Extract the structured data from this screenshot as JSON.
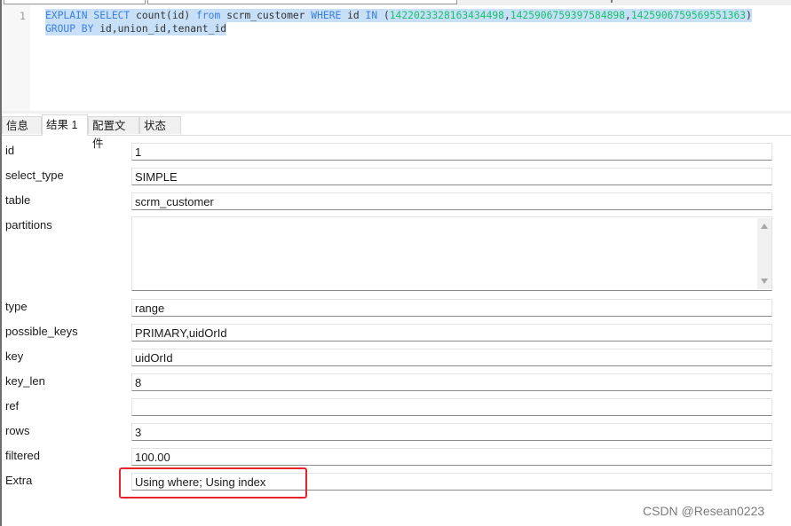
{
  "editor": {
    "line_number": "1",
    "line1": {
      "kw1": "EXPLAIN SELECT",
      "t1": " count(id) ",
      "kw2": "from",
      "t2": " scrm_customer ",
      "kw3": "WHERE",
      "t3": " id ",
      "kw4": "IN",
      "p_open": " (",
      "n1": "1422023328163434498",
      "c1": ",",
      "n2": "1425906759397584898",
      "c2": ",",
      "n3": "1425906759569551363",
      "p_close": ")"
    },
    "line2": {
      "kw": "GROUP BY",
      "t": " id,union_id,tenant_id"
    }
  },
  "tabs": [
    {
      "label": "信息",
      "active": false
    },
    {
      "label": "结果 1",
      "active": true
    },
    {
      "label": "配置文件",
      "active": false
    },
    {
      "label": "状态",
      "active": false
    }
  ],
  "fields": [
    {
      "label": "id",
      "value": "1"
    },
    {
      "label": "select_type",
      "value": "SIMPLE"
    },
    {
      "label": "table",
      "value": "scrm_customer"
    },
    {
      "label": "partitions",
      "value": ""
    },
    {
      "label": "type",
      "value": "range"
    },
    {
      "label": "possible_keys",
      "value": "PRIMARY,uidOrId"
    },
    {
      "label": "key",
      "value": "uidOrId"
    },
    {
      "label": "key_len",
      "value": "8"
    },
    {
      "label": "ref",
      "value": ""
    },
    {
      "label": "rows",
      "value": "3"
    },
    {
      "label": "filtered",
      "value": "100.00"
    },
    {
      "label": "Extra",
      "value": "Using where; Using index"
    }
  ],
  "annotation": {
    "color": "#e8242a",
    "target": "Extra"
  },
  "watermark": "CSDN @Resean0223"
}
